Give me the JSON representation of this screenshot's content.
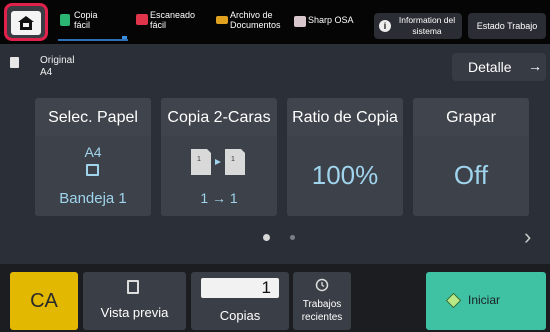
{
  "topbar": {
    "tabs": [
      {
        "label": "Copia\nfácil",
        "icon": "copy-icon",
        "color": "#2bb673"
      },
      {
        "label": "Escaneado\nfácil",
        "icon": "scan-icon",
        "color": "#e0344b"
      },
      {
        "label": "Archivo de\nDocumentos",
        "icon": "folder-icon",
        "color": "#e0a11e"
      },
      {
        "label": "Sharp OSA",
        "icon": "app-icon",
        "color": "#d7c7cc"
      }
    ],
    "info_label": "Information del\nsistema",
    "estado_label": "Estado Trabajo"
  },
  "original": {
    "label": "Original",
    "value": "A4"
  },
  "detalle": {
    "label": "Detalle",
    "arrow": "→"
  },
  "tiles": [
    {
      "title": "Selec. Papel",
      "value": "A4",
      "sub": "Bandeja 1"
    },
    {
      "title": "Copia 2-Caras",
      "sub": "1 → 1"
    },
    {
      "title": "Ratio de Copia",
      "value": "100%"
    },
    {
      "title": "Grapar",
      "value": "Off"
    }
  ],
  "pager": {
    "chevron": "›"
  },
  "bottom": {
    "ca": "CA",
    "vista": "Vista previa",
    "copias_value": "1",
    "copias_label": "Copias",
    "trabajos": "Trabajos\nrecientes",
    "iniciar": "Iniciar"
  },
  "colors": {
    "home_border": "#e0214c",
    "ca": "#e2b800",
    "iniciar": "#3fc2a4",
    "tile_value": "#9fd4ec"
  }
}
